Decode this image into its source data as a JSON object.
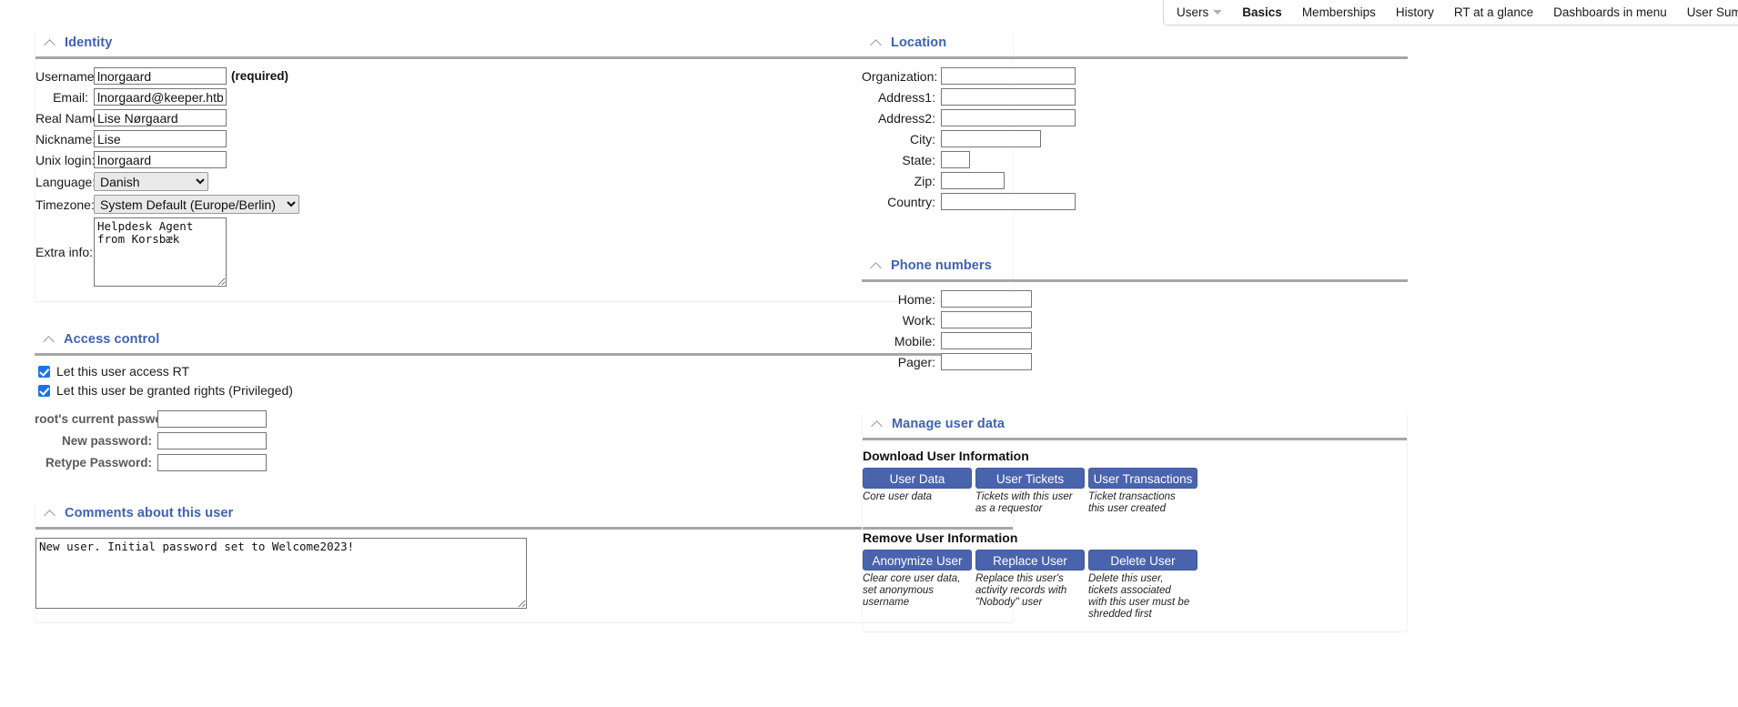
{
  "tabs": {
    "items": [
      {
        "label": "Users",
        "active": false,
        "has_caret": true
      },
      {
        "label": "Basics",
        "active": true,
        "has_caret": false
      },
      {
        "label": "Memberships",
        "active": false,
        "has_caret": false
      },
      {
        "label": "History",
        "active": false,
        "has_caret": false
      },
      {
        "label": "RT at a glance",
        "active": false,
        "has_caret": false
      },
      {
        "label": "Dashboards in menu",
        "active": false,
        "has_caret": false
      },
      {
        "label": "User Summary",
        "active": false,
        "has_caret": false
      }
    ]
  },
  "identity": {
    "title": "Identity",
    "username_label": "Username:",
    "username_value": "lnorgaard",
    "required_note": "(required)",
    "email_label": "Email:",
    "email_value": "lnorgaard@keeper.htb",
    "realname_label": "Real Name:",
    "realname_value": "Lise Nørgaard",
    "nickname_label": "Nickname:",
    "nickname_value": "Lise",
    "unixlogin_label": "Unix login:",
    "unixlogin_value": "lnorgaard",
    "language_label": "Language:",
    "language_value": "Danish",
    "timezone_label": "Timezone:",
    "timezone_value": "System Default (Europe/Berlin)",
    "extrainfo_label": "Extra info:",
    "extrainfo_value": "Helpdesk Agent from Korsbæk"
  },
  "access_control": {
    "title": "Access control",
    "access_rt_label": "Let this user access RT",
    "access_rt_checked": true,
    "privileged_label": "Let this user be granted rights (Privileged)",
    "privileged_checked": true,
    "current_password_label": "root's current password:",
    "current_password_value": "",
    "new_password_label": "New password:",
    "new_password_value": "",
    "retype_password_label": "Retype Password:",
    "retype_password_value": ""
  },
  "comments": {
    "title": "Comments about this user",
    "value": "New user. Initial password set to Welcome2023!"
  },
  "location": {
    "title": "Location",
    "fields": [
      {
        "label": "Organization:",
        "value": "",
        "width": "w-loc"
      },
      {
        "label": "Address1:",
        "value": "",
        "width": "w-loc"
      },
      {
        "label": "Address2:",
        "value": "",
        "width": "w-loc"
      },
      {
        "label": "City:",
        "value": "",
        "width": "w-city"
      },
      {
        "label": "State:",
        "value": "",
        "width": "w-state"
      },
      {
        "label": "Zip:",
        "value": "",
        "width": "w-zip"
      },
      {
        "label": "Country:",
        "value": "",
        "width": "w-loc"
      }
    ]
  },
  "phone_numbers": {
    "title": "Phone numbers",
    "fields": [
      {
        "label": "Home:",
        "value": ""
      },
      {
        "label": "Work:",
        "value": ""
      },
      {
        "label": "Mobile:",
        "value": ""
      },
      {
        "label": "Pager:",
        "value": ""
      }
    ]
  },
  "manage_user_data": {
    "title": "Manage user data",
    "download_heading": "Download User Information",
    "download_buttons": [
      {
        "label": "User Data",
        "help": "Core user data"
      },
      {
        "label": "User Tickets",
        "help": "Tickets with this user as a requestor"
      },
      {
        "label": "User Transactions",
        "help": "Ticket transactions this user created"
      }
    ],
    "remove_heading": "Remove User Information",
    "remove_buttons": [
      {
        "label": "Anonymize User",
        "help": "Clear core user data, set anonymous username"
      },
      {
        "label": "Replace User",
        "help": "Replace this user's activity records with \"Nobody\" user"
      },
      {
        "label": "Delete User",
        "help": "Delete this user, tickets associated with this user must be shredded first"
      }
    ]
  },
  "colors": {
    "heading_blue": "#3f62b4",
    "button_blue": "#4a63ad",
    "checkbox_blue": "#1a73e8",
    "rule_gray": "#a6a6a6"
  }
}
